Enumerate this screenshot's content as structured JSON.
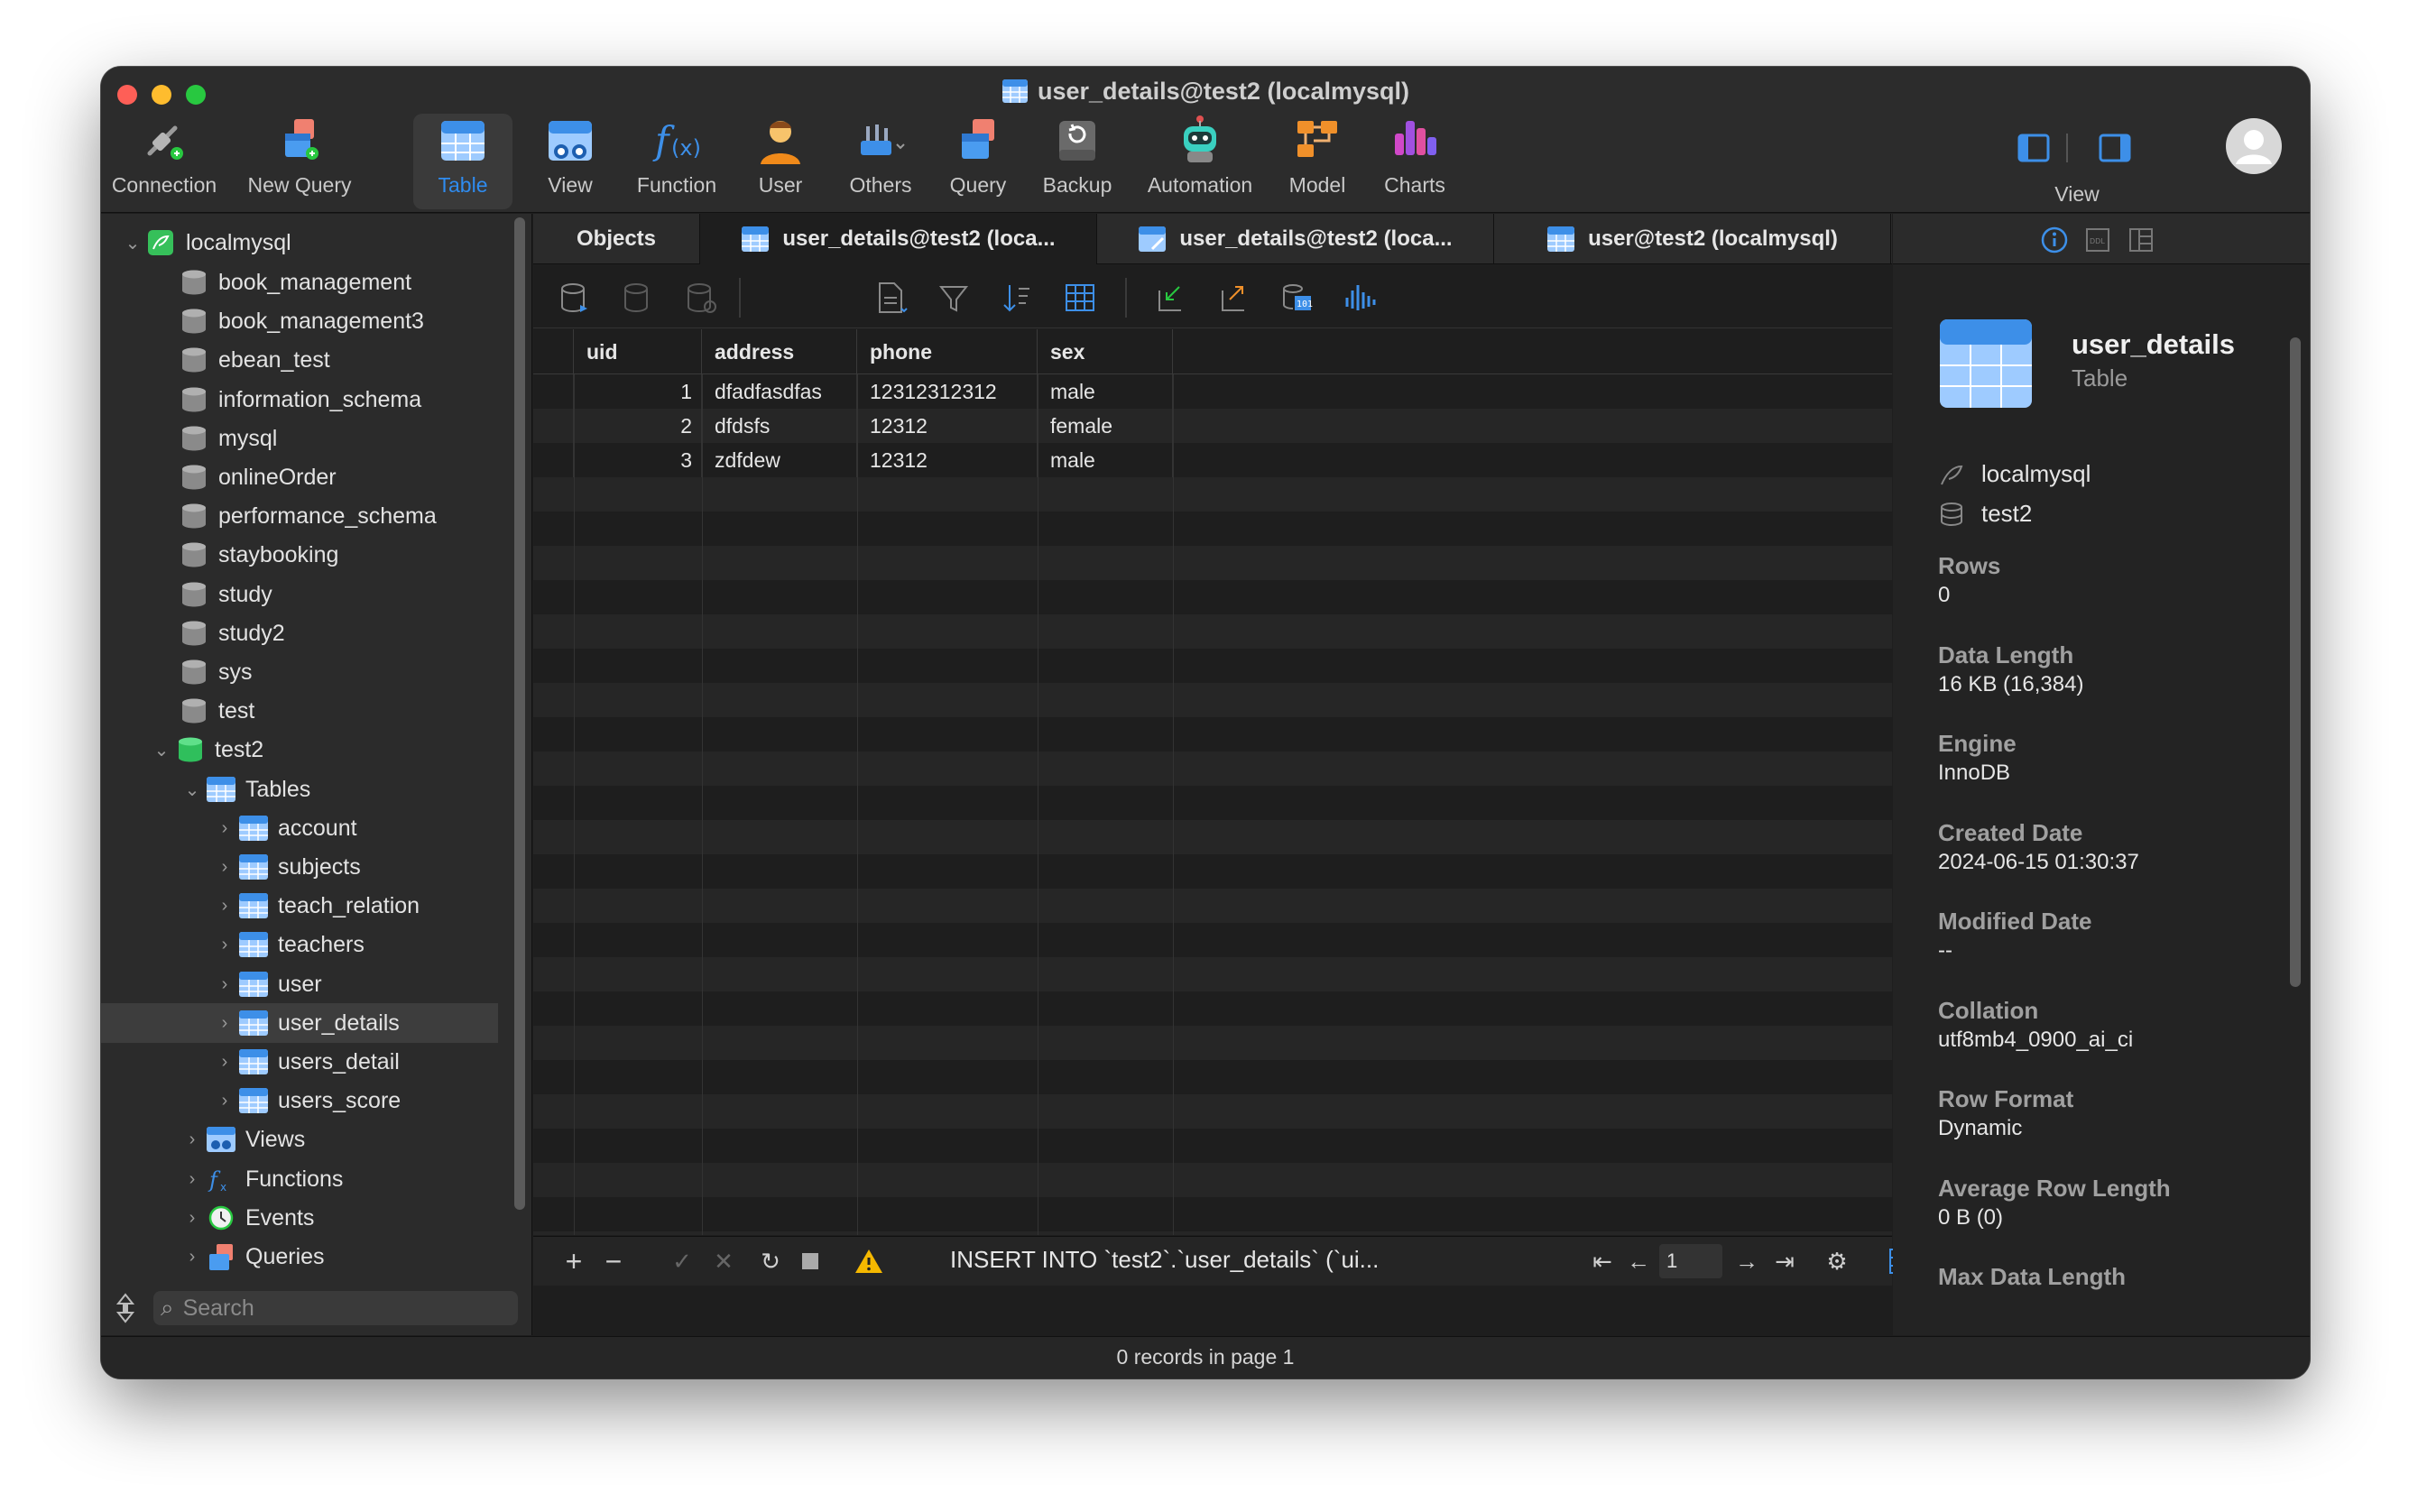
{
  "window": {
    "title": "user_details@test2 (localmysql)"
  },
  "toolbar": {
    "items": [
      {
        "label": "Connection",
        "icon": "connection-icon"
      },
      {
        "label": "New Query",
        "icon": "new-query-icon"
      },
      {
        "label": "Table",
        "icon": "table-icon",
        "active": true
      },
      {
        "label": "View",
        "icon": "view-icon"
      },
      {
        "label": "Function",
        "icon": "function-icon"
      },
      {
        "label": "User",
        "icon": "user-icon"
      },
      {
        "label": "Others",
        "icon": "others-icon"
      },
      {
        "label": "Query",
        "icon": "query-icon"
      },
      {
        "label": "Backup",
        "icon": "backup-icon"
      },
      {
        "label": "Automation",
        "icon": "automation-icon"
      },
      {
        "label": "Model",
        "icon": "model-icon"
      },
      {
        "label": "Charts",
        "icon": "charts-icon"
      }
    ],
    "view_label": "View"
  },
  "sidebar": {
    "connection": "localmysql",
    "databases": [
      "book_management",
      "book_management3",
      "ebean_test",
      "information_schema",
      "mysql",
      "onlineOrder",
      "performance_schema",
      "staybooking",
      "study",
      "study2",
      "sys",
      "test"
    ],
    "open_database": "test2",
    "tables_label": "Tables",
    "tables": [
      "account",
      "subjects",
      "teach_relation",
      "teachers",
      "user",
      "user_details",
      "users_detail",
      "users_score"
    ],
    "selected_table": "user_details",
    "groups": [
      "Views",
      "Functions",
      "Events",
      "Queries"
    ],
    "search_placeholder": "Search"
  },
  "tabs": [
    {
      "label": "Objects"
    },
    {
      "label": "user_details@test2 (loca...",
      "active": true
    },
    {
      "label": "user_details@test2 (loca..."
    },
    {
      "label": "user@test2 (localmysql)"
    }
  ],
  "grid": {
    "columns": [
      "uid",
      "address",
      "phone",
      "sex"
    ],
    "rows": [
      [
        "1",
        "dfadfasdfas",
        "12312312312",
        "male"
      ],
      [
        "2",
        "dfdsfs",
        "12312",
        "female"
      ],
      [
        "3",
        "zdfdew",
        "12312",
        "male"
      ]
    ]
  },
  "bottom": {
    "sql": "INSERT INTO `test2`.`user_details` (`ui...",
    "page": "1"
  },
  "status": {
    "text": "0 records in page 1"
  },
  "inspector": {
    "name": "user_details",
    "type": "Table",
    "connection": "localmysql",
    "database": "test2",
    "props": [
      {
        "label": "Rows",
        "value": "0"
      },
      {
        "label": "Data Length",
        "value": "16 KB (16,384)"
      },
      {
        "label": "Engine",
        "value": "InnoDB"
      },
      {
        "label": "Created Date",
        "value": "2024-06-15 01:30:37"
      },
      {
        "label": "Modified Date",
        "value": "--"
      },
      {
        "label": "Collation",
        "value": "utf8mb4_0900_ai_ci"
      },
      {
        "label": "Row Format",
        "value": "Dynamic"
      },
      {
        "label": "Average Row Length",
        "value": "0 B (0)"
      },
      {
        "label": "Max Data Length",
        "value": ""
      }
    ]
  },
  "colors": {
    "accent": "#2f8cf0",
    "table_blue": "#3d8fe8",
    "db_green": "#2fbf5c"
  }
}
